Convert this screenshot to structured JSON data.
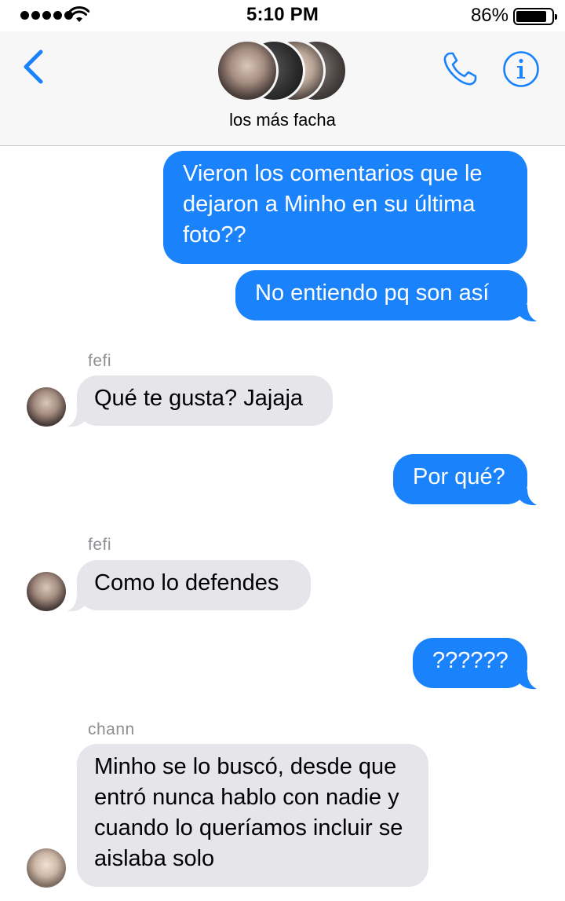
{
  "status_bar": {
    "time": "5:10 PM",
    "battery_percent": "86%",
    "battery_level": 0.86,
    "signal_bars": 5
  },
  "header": {
    "group_name": "los más facha",
    "back_icon": "chevron-left-icon",
    "call_icon": "phone-icon",
    "info_icon": "info-icon",
    "accent_color": "#1a82fb"
  },
  "messages": [
    {
      "direction": "outgoing",
      "text": "Vieron los comentarios que le dejaron a Minho en su última foto??"
    },
    {
      "direction": "outgoing",
      "text": "No entiendo pq son así"
    },
    {
      "direction": "incoming",
      "sender": "fefi",
      "text": "Qué te gusta? Jajaja"
    },
    {
      "direction": "outgoing",
      "text": "Por qué?"
    },
    {
      "direction": "incoming",
      "sender": "fefi",
      "text": "Como lo defendes"
    },
    {
      "direction": "outgoing",
      "text": "??????"
    },
    {
      "direction": "incoming",
      "sender": "chann",
      "text": "Minho se lo buscó, desde que entró nunca hablo con nadie y cuando lo queríamos incluir se aislaba solo"
    }
  ]
}
